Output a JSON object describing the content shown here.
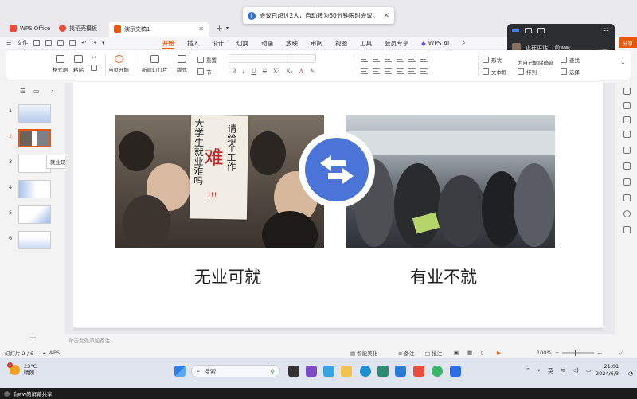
{
  "tabs": [
    {
      "label": "WPS Office",
      "color": "#e84c3d"
    },
    {
      "label": "找稻壳模板",
      "color": "#e84c3d"
    },
    {
      "label": "演示文稿1",
      "color": "#e8590c"
    }
  ],
  "toast": {
    "text": "会议已超过2人，自动转为60分钟限时会议。"
  },
  "meeting": {
    "speaking_label": "正在讲话:",
    "speaker": "俞ww;"
  },
  "menu": {
    "file": "文件",
    "tabs": [
      "开始",
      "插入",
      "设计",
      "切换",
      "动画",
      "放映",
      "审阅",
      "视图",
      "工具",
      "会员专享"
    ],
    "wps_ai": "WPS AI",
    "share": "分享"
  },
  "ribbon": {
    "format_painter": "格式刷",
    "paste": "粘贴",
    "from_current": "当页开始",
    "new_slide": "新建幻灯片",
    "layout": "版式",
    "section": "节",
    "reset": "重置",
    "shape": "形状",
    "textbox": "文本框",
    "arrange": "排列",
    "find": "查找",
    "select": "选择",
    "unmute_self": "为自己解除静音"
  },
  "thumbs": {
    "numbers": [
      "1",
      "2",
      "3",
      "4",
      "5",
      "6"
    ],
    "tooltip": "就业现状"
  },
  "slide": {
    "left_caption": "无业可就",
    "right_caption": "有业不就",
    "sign_col1": "大学生就业难吗",
    "sign_col2": "请给个工作",
    "sign_big": "难",
    "sign_marks": "!!!"
  },
  "notes_placeholder": "单击此处添加备注",
  "status": {
    "slide_counter": "幻灯片 2 / 6",
    "app": "WPS",
    "smart_beautify": "智能美化",
    "notes": "备注",
    "comments": "批注",
    "zoom": "100%"
  },
  "taskbar": {
    "temp": "23°C",
    "weather": "晴朗",
    "badge": "1",
    "search_placeholder": "搜索",
    "lang": "英",
    "time": "21:01",
    "date": "2024/6/3"
  },
  "share_bar": {
    "text": "俞ww的屏幕共享"
  }
}
